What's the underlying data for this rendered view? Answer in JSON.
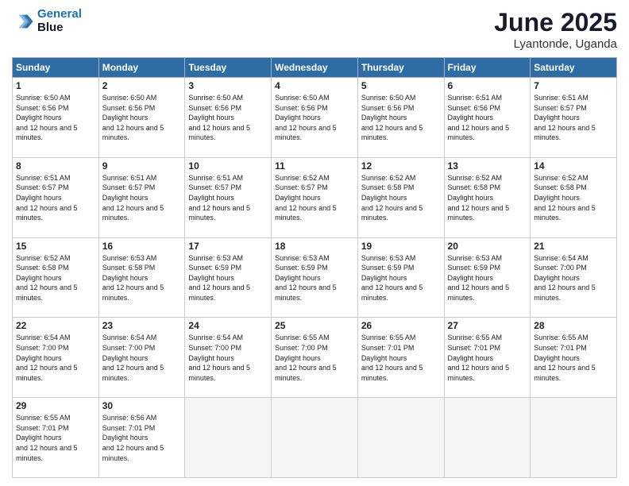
{
  "logo": {
    "line1": "General",
    "line2": "Blue"
  },
  "title": "June 2025",
  "location": "Lyantonde, Uganda",
  "weekdays": [
    "Sunday",
    "Monday",
    "Tuesday",
    "Wednesday",
    "Thursday",
    "Friday",
    "Saturday"
  ],
  "weeks": [
    [
      {
        "day": "1",
        "sunrise": "6:50 AM",
        "sunset": "6:56 PM",
        "daylight": "12 hours and 5 minutes."
      },
      {
        "day": "2",
        "sunrise": "6:50 AM",
        "sunset": "6:56 PM",
        "daylight": "12 hours and 5 minutes."
      },
      {
        "day": "3",
        "sunrise": "6:50 AM",
        "sunset": "6:56 PM",
        "daylight": "12 hours and 5 minutes."
      },
      {
        "day": "4",
        "sunrise": "6:50 AM",
        "sunset": "6:56 PM",
        "daylight": "12 hours and 5 minutes."
      },
      {
        "day": "5",
        "sunrise": "6:50 AM",
        "sunset": "6:56 PM",
        "daylight": "12 hours and 5 minutes."
      },
      {
        "day": "6",
        "sunrise": "6:51 AM",
        "sunset": "6:56 PM",
        "daylight": "12 hours and 5 minutes."
      },
      {
        "day": "7",
        "sunrise": "6:51 AM",
        "sunset": "6:57 PM",
        "daylight": "12 hours and 5 minutes."
      }
    ],
    [
      {
        "day": "8",
        "sunrise": "6:51 AM",
        "sunset": "6:57 PM",
        "daylight": "12 hours and 5 minutes."
      },
      {
        "day": "9",
        "sunrise": "6:51 AM",
        "sunset": "6:57 PM",
        "daylight": "12 hours and 5 minutes."
      },
      {
        "day": "10",
        "sunrise": "6:51 AM",
        "sunset": "6:57 PM",
        "daylight": "12 hours and 5 minutes."
      },
      {
        "day": "11",
        "sunrise": "6:52 AM",
        "sunset": "6:57 PM",
        "daylight": "12 hours and 5 minutes."
      },
      {
        "day": "12",
        "sunrise": "6:52 AM",
        "sunset": "6:58 PM",
        "daylight": "12 hours and 5 minutes."
      },
      {
        "day": "13",
        "sunrise": "6:52 AM",
        "sunset": "6:58 PM",
        "daylight": "12 hours and 5 minutes."
      },
      {
        "day": "14",
        "sunrise": "6:52 AM",
        "sunset": "6:58 PM",
        "daylight": "12 hours and 5 minutes."
      }
    ],
    [
      {
        "day": "15",
        "sunrise": "6:52 AM",
        "sunset": "6:58 PM",
        "daylight": "12 hours and 5 minutes."
      },
      {
        "day": "16",
        "sunrise": "6:53 AM",
        "sunset": "6:58 PM",
        "daylight": "12 hours and 5 minutes."
      },
      {
        "day": "17",
        "sunrise": "6:53 AM",
        "sunset": "6:59 PM",
        "daylight": "12 hours and 5 minutes."
      },
      {
        "day": "18",
        "sunrise": "6:53 AM",
        "sunset": "6:59 PM",
        "daylight": "12 hours and 5 minutes."
      },
      {
        "day": "19",
        "sunrise": "6:53 AM",
        "sunset": "6:59 PM",
        "daylight": "12 hours and 5 minutes."
      },
      {
        "day": "20",
        "sunrise": "6:53 AM",
        "sunset": "6:59 PM",
        "daylight": "12 hours and 5 minutes."
      },
      {
        "day": "21",
        "sunrise": "6:54 AM",
        "sunset": "7:00 PM",
        "daylight": "12 hours and 5 minutes."
      }
    ],
    [
      {
        "day": "22",
        "sunrise": "6:54 AM",
        "sunset": "7:00 PM",
        "daylight": "12 hours and 5 minutes."
      },
      {
        "day": "23",
        "sunrise": "6:54 AM",
        "sunset": "7:00 PM",
        "daylight": "12 hours and 5 minutes."
      },
      {
        "day": "24",
        "sunrise": "6:54 AM",
        "sunset": "7:00 PM",
        "daylight": "12 hours and 5 minutes."
      },
      {
        "day": "25",
        "sunrise": "6:55 AM",
        "sunset": "7:00 PM",
        "daylight": "12 hours and 5 minutes."
      },
      {
        "day": "26",
        "sunrise": "6:55 AM",
        "sunset": "7:01 PM",
        "daylight": "12 hours and 5 minutes."
      },
      {
        "day": "27",
        "sunrise": "6:55 AM",
        "sunset": "7:01 PM",
        "daylight": "12 hours and 5 minutes."
      },
      {
        "day": "28",
        "sunrise": "6:55 AM",
        "sunset": "7:01 PM",
        "daylight": "12 hours and 5 minutes."
      }
    ],
    [
      {
        "day": "29",
        "sunrise": "6:55 AM",
        "sunset": "7:01 PM",
        "daylight": "12 hours and 5 minutes."
      },
      {
        "day": "30",
        "sunrise": "6:56 AM",
        "sunset": "7:01 PM",
        "daylight": "12 hours and 5 minutes."
      },
      null,
      null,
      null,
      null,
      null
    ]
  ]
}
